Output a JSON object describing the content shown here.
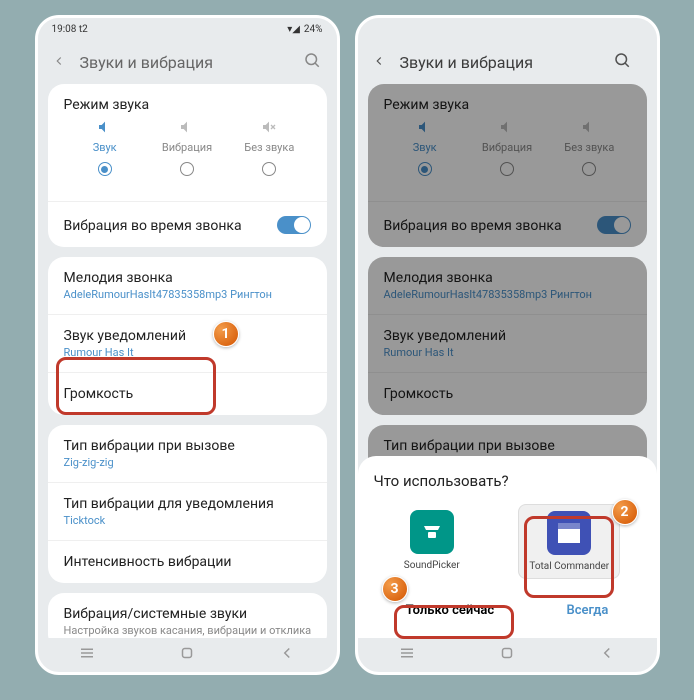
{
  "statusbar": {
    "time": "19:08 t2",
    "battery": "24%"
  },
  "header": {
    "title": "Звуки и вибрация"
  },
  "modes": {
    "title": "Режим звука",
    "items": [
      {
        "label": "Звук",
        "active": true
      },
      {
        "label": "Вибрация",
        "active": false
      },
      {
        "label": "Без звука",
        "active": false
      }
    ]
  },
  "vibration_call": {
    "label": "Вибрация во время звонка"
  },
  "ringtone": {
    "label": "Мелодия звонка",
    "value": "AdeleRumourHasIt47835358mp3 Рингтон"
  },
  "notification": {
    "label": "Звук уведомлений",
    "value": "Rumour Has It"
  },
  "volume": {
    "label": "Громкость"
  },
  "vib_call": {
    "label": "Тип вибрации при вызове",
    "value": "Zig-zig-zig"
  },
  "vib_notif": {
    "label": "Тип вибрации для уведомления",
    "value": "Ticktock"
  },
  "vib_intensity": {
    "label": "Интенсивность вибрации"
  },
  "system_sounds": {
    "label": "Вибрация/системные звуки",
    "value": "Настройка звуков касания, вибрации и отклика клавиатуры."
  },
  "sheet": {
    "title": "Что использовать?",
    "app1": "SoundPicker",
    "app2": "Total Commander",
    "once": "Только сейчас",
    "always": "Всегда"
  },
  "badges": {
    "b1": "1",
    "b2": "2",
    "b3": "3"
  }
}
